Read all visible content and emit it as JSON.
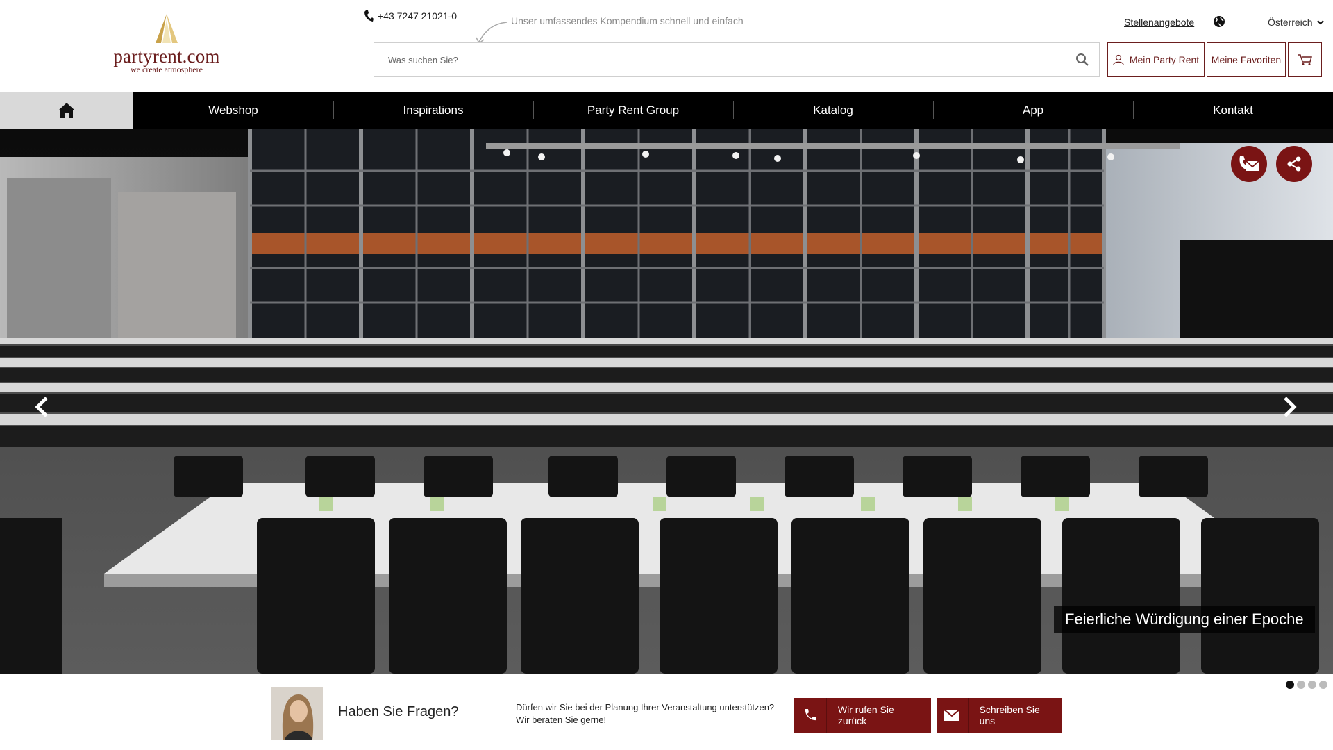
{
  "brand": {
    "name": "partyrent.com",
    "tagline": "we create atmosphere"
  },
  "header": {
    "phone": "+43 7247 21021-0",
    "hint": "Unser umfassendes Kompendium schnell und einfach",
    "search_placeholder": "Was suchen Sie?",
    "jobs_link": "Stellenangebote",
    "country": "Österreich",
    "account_button": "Mein Party Rent",
    "favorites_button": "Meine Favoriten"
  },
  "nav": {
    "items": [
      "Webshop",
      "Inspirations",
      "Party Rent Group",
      "Katalog",
      "App",
      "Kontakt"
    ]
  },
  "hero": {
    "caption": "Feierliche Würdigung einer Epoche",
    "slide_count": 4,
    "active_slide": 1
  },
  "contact": {
    "title": "Haben Sie Fragen?",
    "line1": "Dürfen wir Sie bei der Planung Ihrer Veranstaltung unterstützen?",
    "line2": "Wir beraten Sie gerne!",
    "call_button": "Wir rufen Sie zurück",
    "write_button": "Schreiben Sie uns"
  },
  "colors": {
    "brand": "#7a1414",
    "nav": "#000000",
    "home_tab": "#d9d9d9"
  }
}
